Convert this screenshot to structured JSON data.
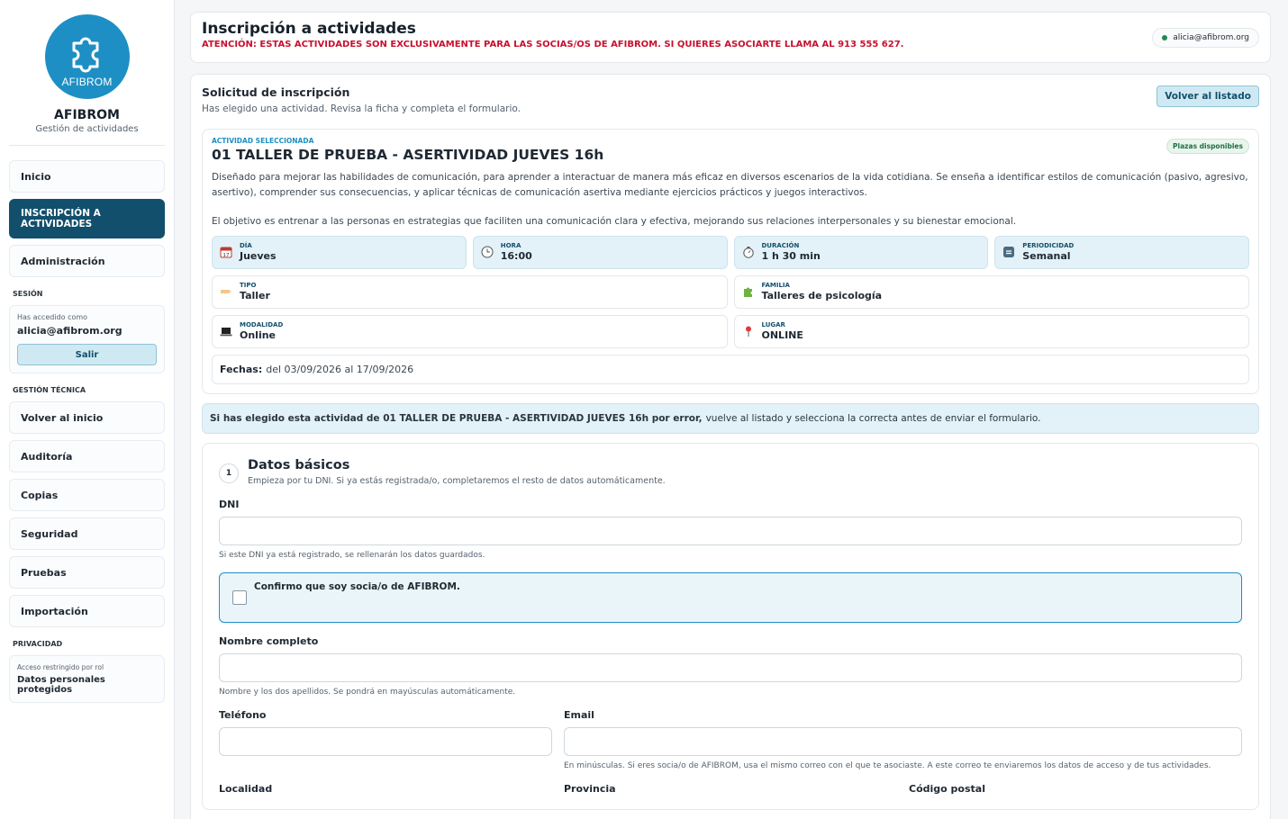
{
  "brand": {
    "name": "AFIBROM",
    "subtitle": "Gestión de actividades",
    "logo_text": "AFIBROM",
    "color": "#1d8fc4"
  },
  "nav": {
    "home": "Inicio",
    "inscription": "INSCRIPCIÓN A ACTIVIDADES",
    "admin": "Administración"
  },
  "session": {
    "section": "SESIÓN",
    "logged_as": "Has accedido como",
    "email": "alicia@afibrom.org",
    "logout": "Salir"
  },
  "tech": {
    "section": "GESTIÓN TÉCNICA",
    "items": [
      "Volver al inicio",
      "Auditoría",
      "Copias",
      "Seguridad",
      "Pruebas",
      "Importación"
    ]
  },
  "privacy": {
    "section": "PRIVACIDAD",
    "small": "Acceso restringido por rol",
    "strong": "Datos personales protegidos"
  },
  "header": {
    "title": "Inscripción a actividades",
    "warning": "ATENCIÓN: ESTAS ACTIVIDADES SON EXCLUSIVAMENTE PARA LAS SOCIAS/OS DE AFIBROM. SI QUIERES ASOCIARTE LLAMA AL 913 555 627.",
    "user": "alicia@afibrom.org"
  },
  "form": {
    "title": "Solicitud de inscripción",
    "subtitle": "Has elegido una actividad. Revisa la ficha y completa el formulario.",
    "back": "Volver al listado"
  },
  "activity": {
    "label": "ACTIVIDAD SELECCIONADA",
    "title": "01 TALLER DE PRUEBA - ASERTIVIDAD JUEVES 16h",
    "badge": "Plazas disponibles",
    "desc1": "Diseñado para mejorar las habilidades de comunicación, para aprender a interactuar de manera más eficaz en diversos escenarios de la vida cotidiana. Se enseña a identificar estilos de comunicación (pasivo, agresivo, asertivo), comprender sus consecuencias, y aplicar técnicas de comunicación asertiva mediante ejercicios prácticos y juegos interactivos.",
    "desc2": "El objetivo es entrenar a las personas en estrategias que faciliten una comunicación clara y efectiva, mejorando sus relaciones interpersonales y su bienestar emocional.",
    "day_label": "DÍA",
    "day": "Jueves",
    "hour_label": "HORA",
    "hour": "16:00",
    "duration_label": "DURACIÓN",
    "duration": "1 h 30 min",
    "period_label": "PERIODICIDAD",
    "period": "Semanal",
    "type_label": "TIPO",
    "type": "Taller",
    "family_label": "FAMILIA",
    "family": "Talleres de psicología",
    "mode_label": "MODALIDAD",
    "mode": "Online",
    "place_label": "LUGAR",
    "place": "ONLINE",
    "dates_label": "Fechas:",
    "dates": "del 03/09/2026 al 17/09/2026"
  },
  "notice": {
    "bold": "Si has elegido esta actividad de 01 TALLER DE PRUEBA - ASERTIVIDAD JUEVES 16h por error,",
    "rest": "vuelve al listado y selecciona la correcta antes de enviar el formulario."
  },
  "basics": {
    "num": "1",
    "title": "Datos básicos",
    "subtitle": "Empieza por tu DNI. Si ya estás registrada/o, completaremos el resto de datos automáticamente.",
    "dni_label": "DNI",
    "dni_hint": "Si este DNI ya está registrado, se rellenarán los datos guardados.",
    "confirm": "Confirmo que soy socia/o de AFIBROM.",
    "name_label": "Nombre completo",
    "name_hint": "Nombre y los dos apellidos. Se pondrá en mayúsculas automáticamente.",
    "phone_label": "Teléfono",
    "email_label": "Email",
    "email_hint": "En minúsculas. Si eres socia/o de AFIBROM, usa el mismo correo con el que te asociaste. A este correo te enviaremos los datos de acceso y de tus actividades.",
    "city_label": "Localidad",
    "province_label": "Provincia",
    "zip_label": "Código postal"
  }
}
